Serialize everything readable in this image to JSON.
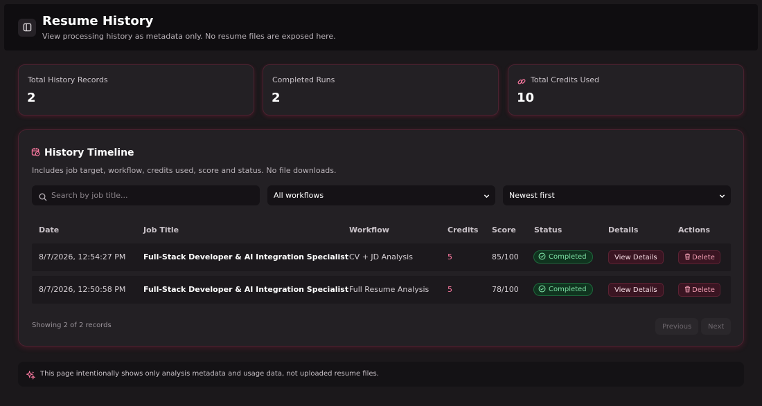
{
  "header": {
    "title": "Resume History",
    "subtitle": "View processing history as metadata only. No resume files are exposed here."
  },
  "stats": [
    {
      "label": "Total History Records",
      "value": "2"
    },
    {
      "label": "Completed Runs",
      "value": "2"
    },
    {
      "label": "Total Credits Used",
      "value": "10",
      "icon": "link-icon"
    }
  ],
  "timeline": {
    "title": "History Timeline",
    "description": "Includes job target, workflow, credits used, score and status. No file downloads.",
    "search": {
      "placeholder": "Search by job title...",
      "value": ""
    },
    "workflow_filter": {
      "selected": "All workflows"
    },
    "sort_filter": {
      "selected": "Newest first"
    },
    "columns": [
      "Date",
      "Job Title",
      "Workflow",
      "Credits",
      "Score",
      "Status",
      "Details",
      "Actions"
    ],
    "rows": [
      {
        "date": "8/7/2026, 12:54:27 PM",
        "job_title": "Full-Stack Developer & AI Integration Specialist",
        "workflow": "CV + JD Analysis",
        "credits": "5",
        "score": "85/100",
        "status": "Completed",
        "details": "View Details",
        "action": "Delete"
      },
      {
        "date": "8/7/2026, 12:50:58 PM",
        "job_title": "Full-Stack Developer & AI Integration Specialist",
        "workflow": "Full Resume Analysis",
        "credits": "5",
        "score": "78/100",
        "status": "Completed",
        "details": "View Details",
        "action": "Delete"
      }
    ],
    "showing": "Showing 2 of 2 records",
    "pagination": {
      "previous": "Previous",
      "next": "Next"
    }
  },
  "footer": {
    "note": "This page intentionally shows only analysis metadata and usage data, not uploaded resume files."
  },
  "colors": {
    "accent": "#ff7aa2",
    "card_border": "#4a2230",
    "status_completed": "#7ee2a6",
    "background": "#1b181b"
  }
}
